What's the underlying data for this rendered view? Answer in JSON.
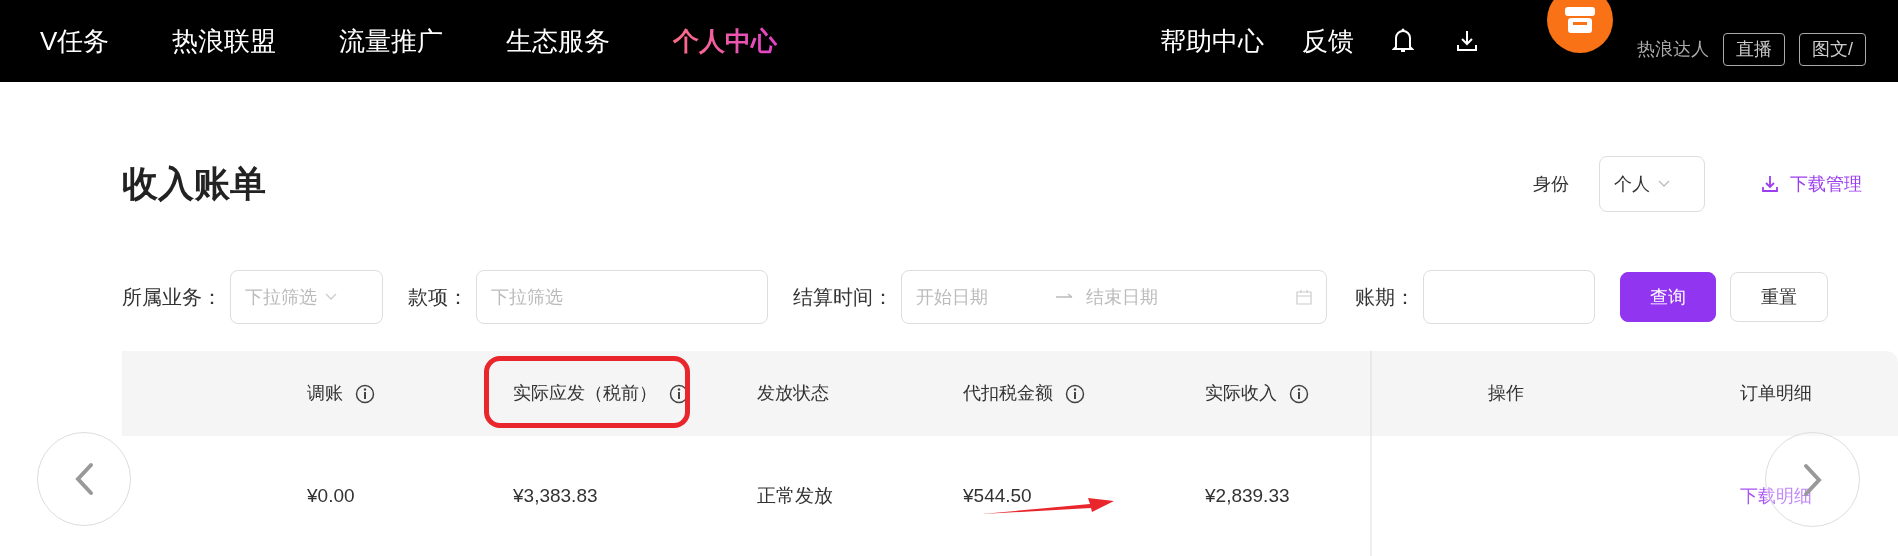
{
  "top_nav": {
    "items": [
      {
        "label": "V任务",
        "selected": false
      },
      {
        "label": "热浪联盟",
        "selected": false
      },
      {
        "label": "流量推广",
        "selected": false
      },
      {
        "label": "生态服务",
        "selected": false
      },
      {
        "label": "个人中心",
        "selected": true
      }
    ],
    "links": [
      "帮助中心",
      "反馈"
    ],
    "user": {
      "role": "热浪达人",
      "tags": [
        "直播",
        "图文/"
      ]
    }
  },
  "page": {
    "title": "收入账单",
    "identity_label": "身份",
    "identity_value": "个人",
    "download_link": "下载管理"
  },
  "filters": [
    {
      "kind": "select",
      "label": "所属业务：",
      "placeholder": "下拉筛选"
    },
    {
      "kind": "input",
      "label": "款项：",
      "placeholder": "下拉筛选"
    },
    {
      "kind": "range",
      "label": "结算时间：",
      "placeholder": "开始日期",
      "placeholder_end": "结束日期"
    },
    {
      "kind": "input",
      "label": "账期："
    }
  ],
  "buttons": [
    {
      "label": "查询",
      "primary": true
    },
    {
      "label": "重置",
      "primary": false
    }
  ],
  "table": {
    "columns": [
      {
        "label": "调账",
        "info": true
      },
      {
        "label": "实际应发（税前）",
        "info": true
      },
      {
        "label": "发放状态",
        "info": false
      },
      {
        "label": "代扣税金额",
        "info": true
      },
      {
        "label": "实际收入",
        "info": true
      },
      {
        "label": "操作",
        "info": false
      },
      {
        "label": "订单明细",
        "info": false
      }
    ],
    "rows": [
      [
        "¥0.00",
        "¥3,383.83",
        "正常发放",
        "¥544.50",
        "¥2,839.33",
        "",
        "下载明细"
      ]
    ]
  }
}
